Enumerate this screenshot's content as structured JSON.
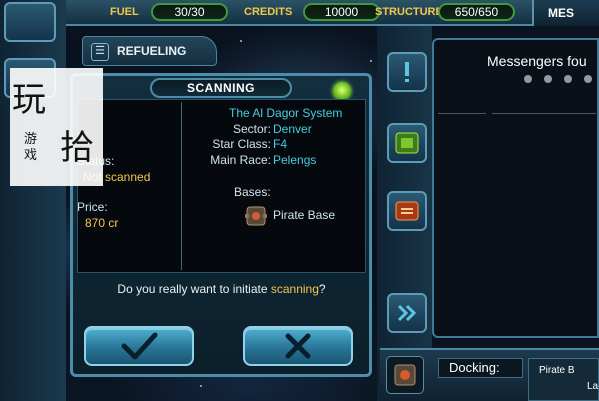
{
  "topbar": {
    "fuel_label": "FUEL",
    "fuel_value": "30/30",
    "credits_label": "CREDITS",
    "credits_value": "10000",
    "structure_label": "STRUCTURE",
    "structure_value": "650/650",
    "tab_label": "MES"
  },
  "refueling": {
    "label": "REFUELING"
  },
  "watermark": {
    "chars": [
      "玩",
      "游",
      "戏",
      "拾"
    ]
  },
  "dialog": {
    "title": "SCANNING",
    "status_label": "Status:",
    "status_value": "Not scanned",
    "price_label": "Price:",
    "price_value": "870 cr",
    "system_name": "The Al Dagor System",
    "sector_label": "Sector:",
    "sector_value": "Denver",
    "starclass_label": "Star Class:",
    "starclass_value": "F4",
    "race_label": "Main Race:",
    "race_value": "Pelengs",
    "bases_label": "Bases:",
    "base_name": "Pirate Base",
    "question_prefix": "Do you really want to initiate ",
    "question_highlight": "scanning",
    "question_suffix": "?"
  },
  "messengers": {
    "title": "Messengers fou"
  },
  "docking": {
    "label": "Docking:",
    "info_line1": "Pirate B",
    "info_line2": "La"
  },
  "colors": {
    "accent_yellow": "#f2c74a",
    "accent_cyan": "#46cde0",
    "frame_blue": "#4c8eaa",
    "status_green": "#6fbf21"
  }
}
